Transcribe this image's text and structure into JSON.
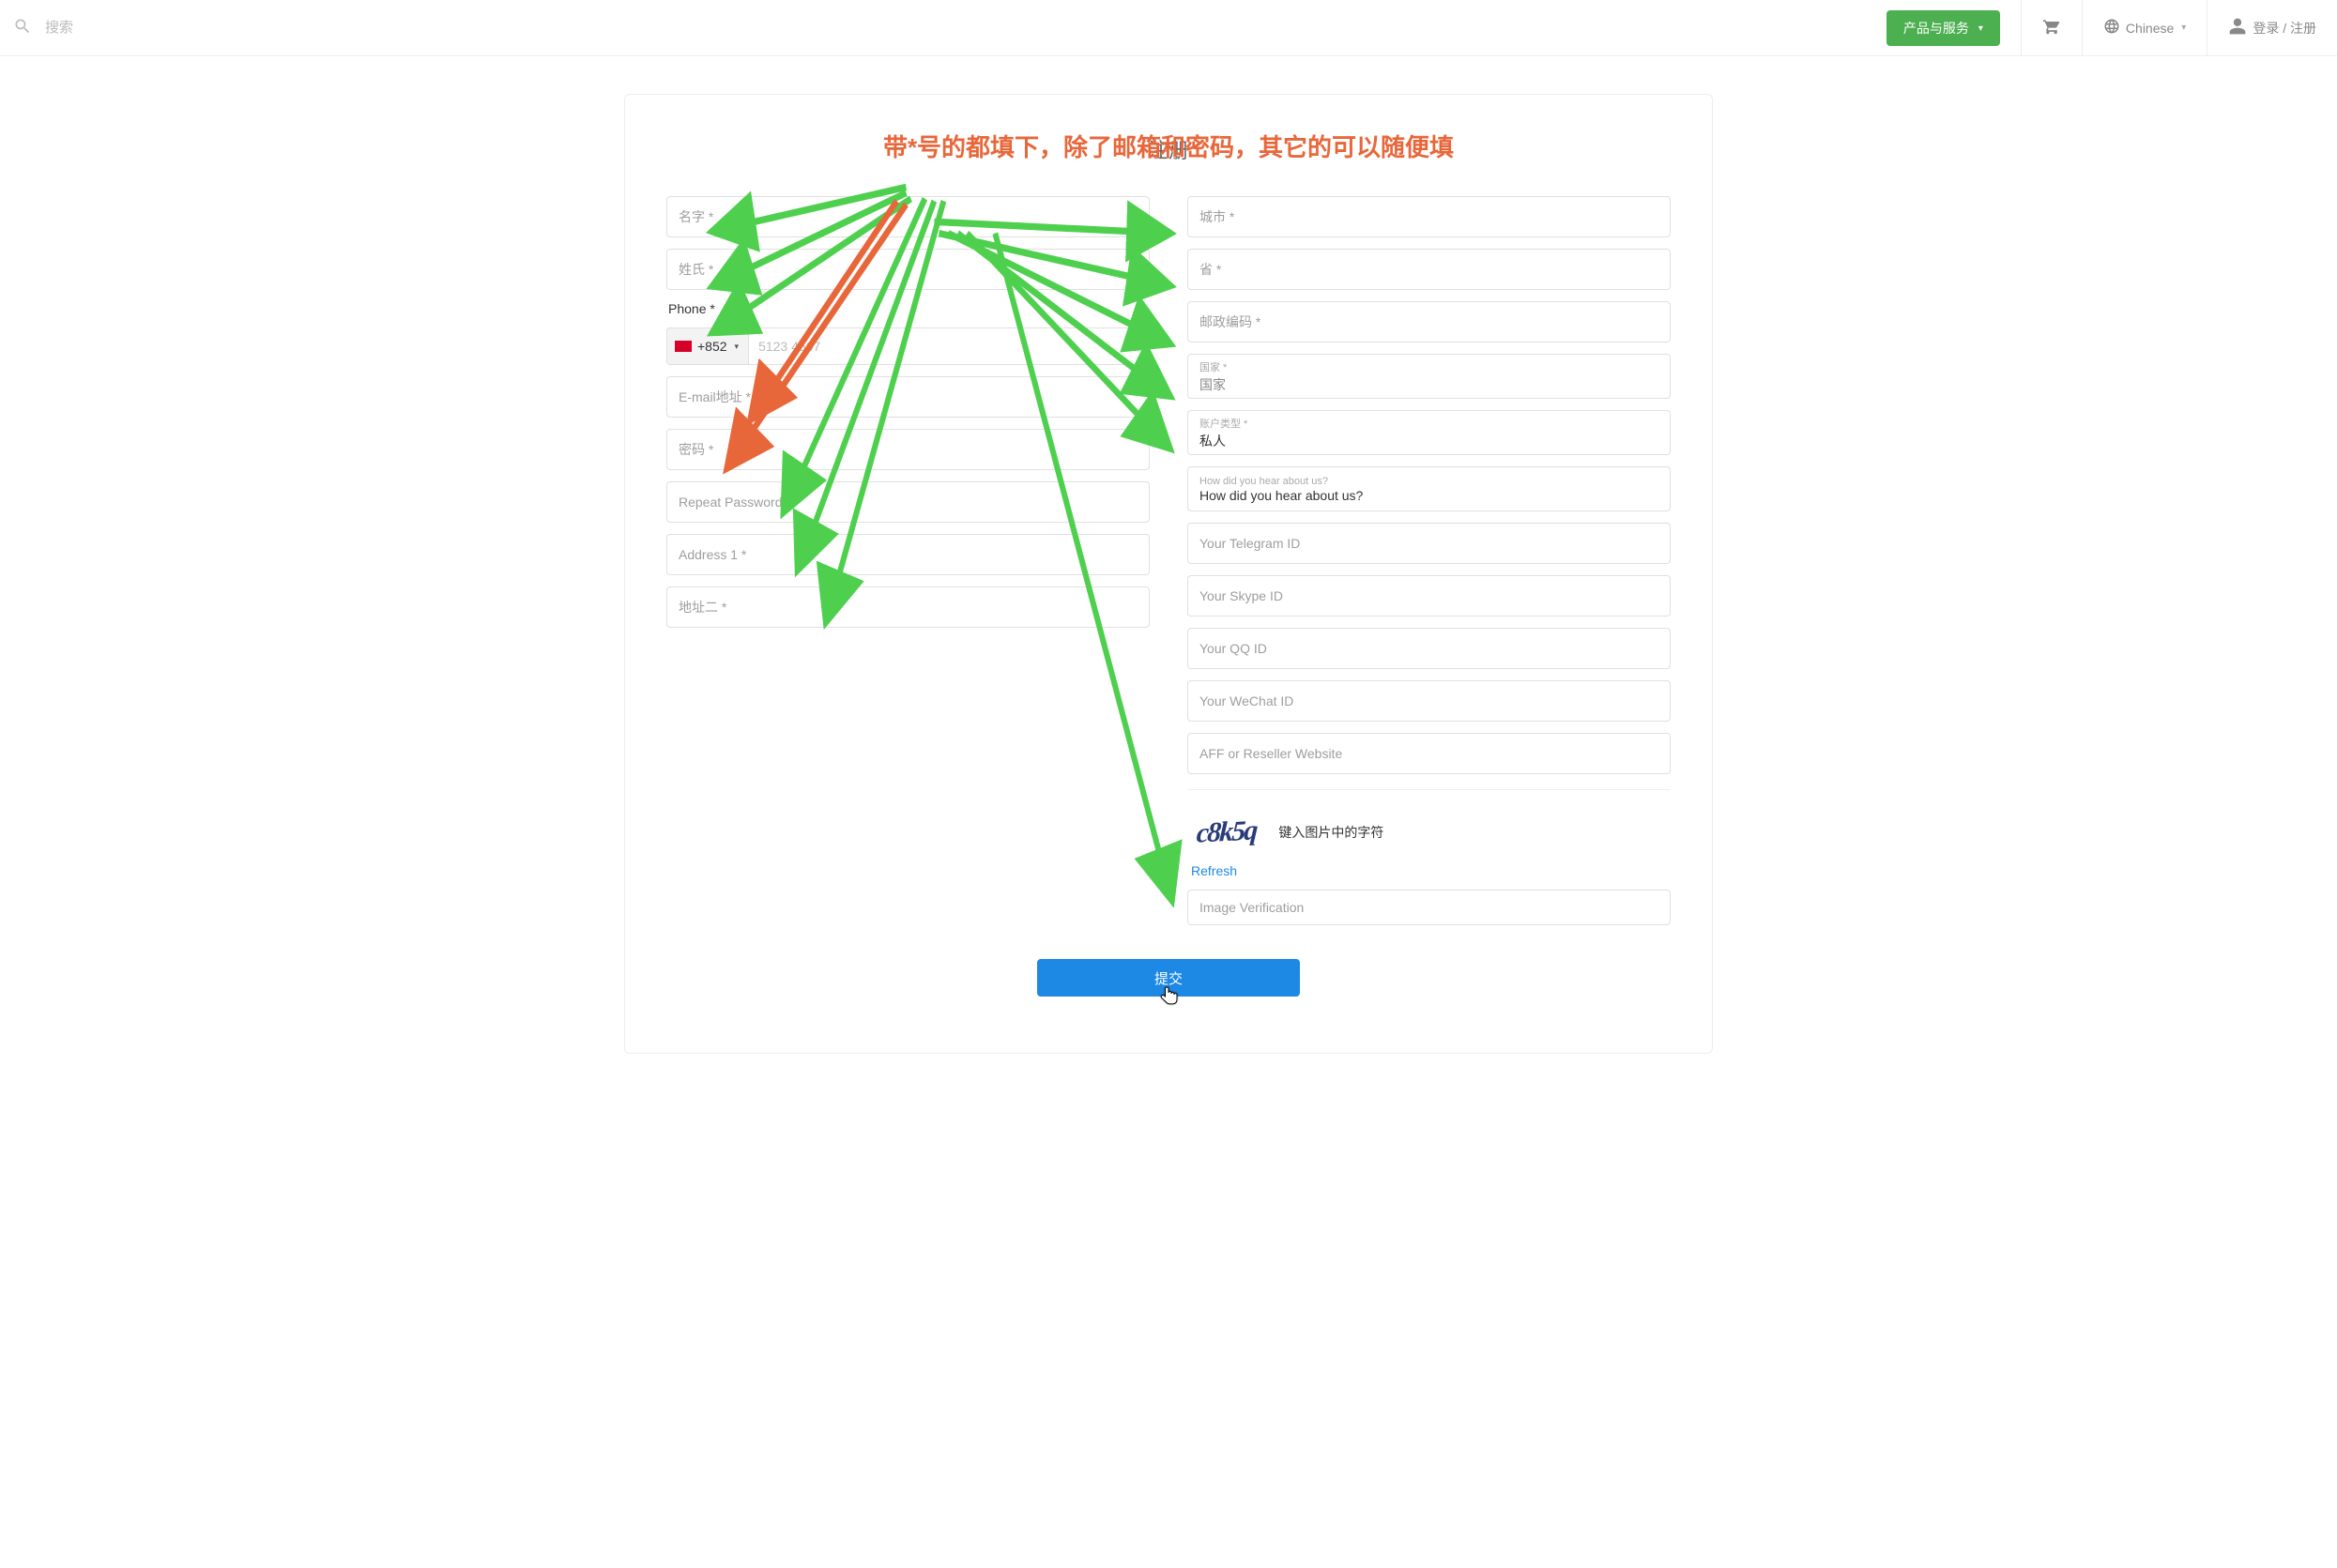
{
  "header": {
    "searchPlaceholder": "搜索",
    "productsBtn": "产品与服务",
    "language": "Chinese",
    "login": "登录 / 注册"
  },
  "card": {
    "title": "注册",
    "annotation": "带*号的都填下，除了邮箱和密码，其它的可以随便填"
  },
  "left": {
    "firstName": "名字 *",
    "lastName": "姓氏 *",
    "phoneLabel": "Phone *",
    "phoneCC": "+852",
    "phonePlaceholder": "5123 4567",
    "email": "E-mail地址 *",
    "password": "密码 *",
    "repeatPassword": "Repeat Password *",
    "address1": "Address 1 *",
    "address2": "地址二 *"
  },
  "right": {
    "city": "城市 *",
    "province": "省 *",
    "postal": "邮政编码 *",
    "countryLabel": "国家 *",
    "countryValue": "国家",
    "accountTypeLabel": "账户类型 *",
    "accountTypeValue": "私人",
    "hearLabel": "How did you hear about us?",
    "hearValue": "How did you hear about us?",
    "telegram": "Your Telegram ID",
    "skype": "Your Skype ID",
    "qq": "Your QQ ID",
    "wechat": "Your WeChat ID",
    "affiliate": "AFF or Reseller Website",
    "captchaText": "c8k5q",
    "captchaLabel": "键入图片中的字符",
    "refresh": "Refresh",
    "imageVerification": "Image Verification"
  },
  "submit": "提交"
}
